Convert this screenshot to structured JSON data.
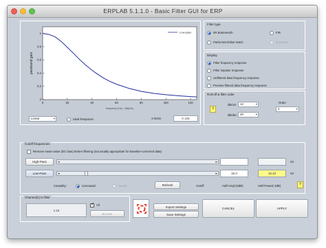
{
  "window": {
    "title": "ERPLAB 5.1.1.0   -   Basic Filter GUI for ERP"
  },
  "plot": {
    "ylabel": "passband gain",
    "xlabel": "frequency (Hz) - 3db(Hz)",
    "legend": "Low-pass",
    "yticks": [
      "0",
      "0.2",
      "0.4",
      "0.6",
      "0.8",
      "1"
    ],
    "xticks": [
      "0",
      "20",
      "40",
      "60",
      "80",
      "100",
      "120"
    ],
    "scale_value": "Linear",
    "ideal_response_label": "Ideal Response",
    "x_limits_label": "X limits",
    "x_limits_value": "0  125"
  },
  "chart_data": {
    "type": "line",
    "series": [
      {
        "name": "Low-pass",
        "x": [
          0,
          5,
          10,
          15,
          20,
          25,
          30,
          35,
          40,
          45,
          50,
          55,
          60,
          70,
          80,
          90,
          100,
          110,
          120,
          125
        ],
        "y": [
          1.0,
          0.985,
          0.95,
          0.88,
          0.79,
          0.7,
          0.605,
          0.52,
          0.445,
          0.378,
          0.32,
          0.272,
          0.232,
          0.17,
          0.125,
          0.095,
          0.074,
          0.058,
          0.046,
          0.04
        ]
      }
    ],
    "xlim": [
      0,
      125
    ],
    "ylim": [
      0,
      1.1
    ],
    "color": "#1f2a9c"
  },
  "filter_type": {
    "title": "Filter type",
    "options": [
      {
        "label": "IIR Butterworth",
        "selected": true,
        "enabled": true
      },
      {
        "label": "FIR",
        "selected": false,
        "enabled": true
      },
      {
        "label": "Parks-McClellan Notch",
        "selected": false,
        "enabled": true
      },
      {
        "label": "Gaussian",
        "selected": false,
        "enabled": false
      }
    ]
  },
  "display": {
    "title": "Display",
    "options": [
      {
        "label": "Filter frequency response",
        "selected": true
      },
      {
        "label": "Filter impulse response",
        "selected": false
      },
      {
        "label": "Unfiltered data frequency response",
        "selected": false
      },
      {
        "label": "Preview filtered data frequency response",
        "selected": false
      }
    ]
  },
  "rolloff": {
    "title": "Roll-off & filter order",
    "help": "?",
    "db_oct_label": "dB/oct",
    "db_oct_value": "12",
    "db_dec_label": "dB/dec",
    "db_dec_value": "40",
    "order_label": "Order",
    "order_value": "2"
  },
  "cutoff": {
    "title": "Cutoff frequencies",
    "remove_mean_label": "Remove mean value (DC bias) before filtering (not usually appropriate for baseline-corrected data)",
    "highpass_label": "High-Pass",
    "lowpass_label": "Low-Pass",
    "highpass_value": "",
    "lowpass_value": "30.0",
    "half_power_value": "19.40",
    "unit_hz": "Hz",
    "causality_label": "Causality:",
    "noncausal_label": "noncausal",
    "causal_label": "causal",
    "refresh_label": "Refresh",
    "cutoff_label": "Cutoff",
    "half_amp_label": "Half-Ampl (6dB)",
    "half_power_label": "Half-Power(-3dB)",
    "help": "?"
  },
  "channels": {
    "title": "Channel(s) to filter",
    "value": "1:16",
    "all_label": "All",
    "browse_label": "Browse"
  },
  "actions": {
    "import_label": "Import Settings",
    "save_label": "Save Settings",
    "cancel_label": "CANCEL",
    "apply_label": "APPLY"
  }
}
